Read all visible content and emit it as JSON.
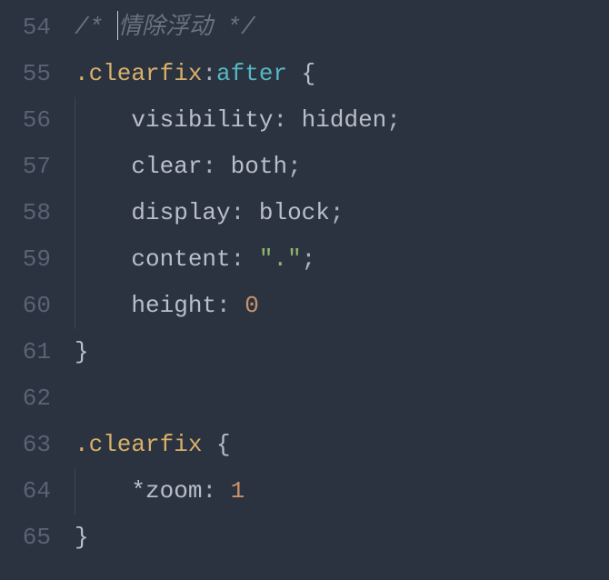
{
  "editor": {
    "lines": [
      {
        "num": 54,
        "indent": 0,
        "tokens": [
          {
            "cls": "tok-comment",
            "text": "/* "
          },
          {
            "cls": "cursor",
            "text": ""
          },
          {
            "cls": "tok-comment",
            "text": "情除浮动 */"
          }
        ]
      },
      {
        "num": 55,
        "indent": 0,
        "tokens": [
          {
            "cls": "tok-selector",
            "text": ".clearfix"
          },
          {
            "cls": "tok-punct",
            "text": ":"
          },
          {
            "cls": "tok-pseudo",
            "text": "after"
          },
          {
            "cls": "tok-brace",
            "text": " {"
          }
        ]
      },
      {
        "num": 56,
        "indent": 1,
        "tokens": [
          {
            "cls": "tok-property",
            "text": "    visibility"
          },
          {
            "cls": "tok-colon",
            "text": ": "
          },
          {
            "cls": "tok-value",
            "text": "hidden"
          },
          {
            "cls": "tok-punct",
            "text": ";"
          }
        ]
      },
      {
        "num": 57,
        "indent": 1,
        "tokens": [
          {
            "cls": "tok-property",
            "text": "    clear"
          },
          {
            "cls": "tok-colon",
            "text": ": "
          },
          {
            "cls": "tok-value",
            "text": "both"
          },
          {
            "cls": "tok-punct",
            "text": ";"
          }
        ]
      },
      {
        "num": 58,
        "indent": 1,
        "tokens": [
          {
            "cls": "tok-property",
            "text": "    display"
          },
          {
            "cls": "tok-colon",
            "text": ": "
          },
          {
            "cls": "tok-value",
            "text": "block"
          },
          {
            "cls": "tok-punct",
            "text": ";"
          }
        ]
      },
      {
        "num": 59,
        "indent": 1,
        "tokens": [
          {
            "cls": "tok-property",
            "text": "    content"
          },
          {
            "cls": "tok-colon",
            "text": ": "
          },
          {
            "cls": "tok-string",
            "text": "\".\""
          },
          {
            "cls": "tok-punct",
            "text": ";"
          }
        ]
      },
      {
        "num": 60,
        "indent": 1,
        "tokens": [
          {
            "cls": "tok-property",
            "text": "    height"
          },
          {
            "cls": "tok-colon",
            "text": ": "
          },
          {
            "cls": "tok-number",
            "text": "0"
          }
        ]
      },
      {
        "num": 61,
        "indent": 0,
        "tokens": [
          {
            "cls": "tok-brace",
            "text": "}"
          }
        ]
      },
      {
        "num": 62,
        "indent": 0,
        "tokens": []
      },
      {
        "num": 63,
        "indent": 0,
        "tokens": [
          {
            "cls": "tok-selector",
            "text": ".clearfix"
          },
          {
            "cls": "tok-brace",
            "text": " {"
          }
        ]
      },
      {
        "num": 64,
        "indent": 1,
        "tokens": [
          {
            "cls": "tok-property",
            "text": "    *zoom"
          },
          {
            "cls": "tok-colon",
            "text": ": "
          },
          {
            "cls": "tok-number",
            "text": "1"
          }
        ]
      },
      {
        "num": 65,
        "indent": 0,
        "tokens": [
          {
            "cls": "tok-brace",
            "text": "}"
          }
        ]
      }
    ]
  }
}
